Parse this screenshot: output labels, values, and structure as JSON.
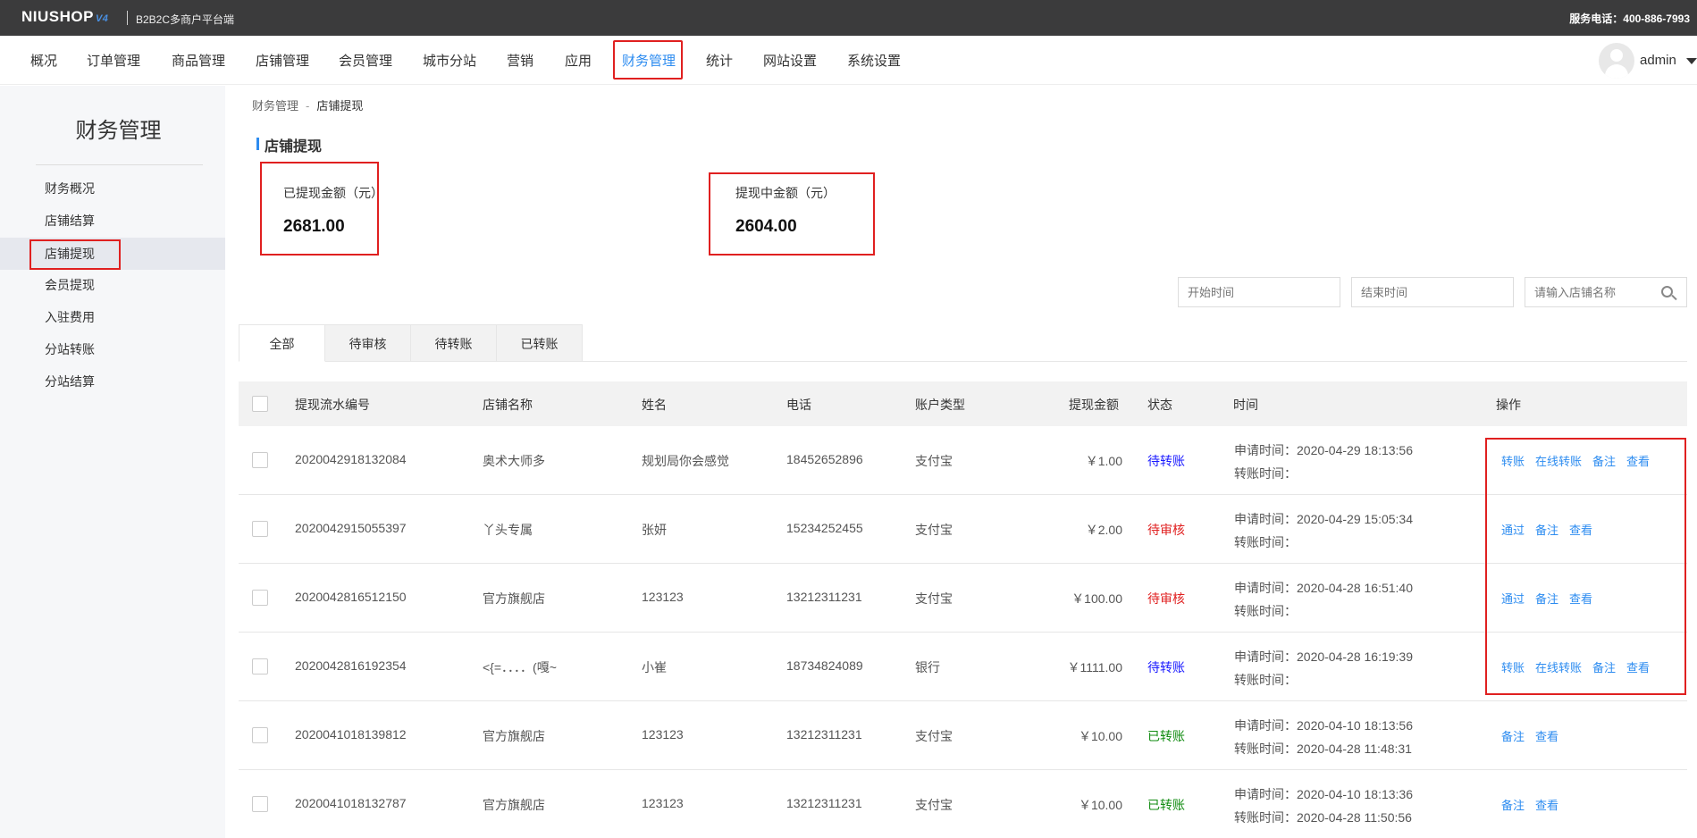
{
  "header": {
    "logo": "NIUSHOP",
    "logo_version": "V4",
    "subtitle": "B2B2C多商户平台端",
    "hotline": "服务电话：400-886-7993"
  },
  "nav": {
    "items": [
      {
        "label": "概况"
      },
      {
        "label": "订单管理"
      },
      {
        "label": "商品管理"
      },
      {
        "label": "店铺管理"
      },
      {
        "label": "会员管理"
      },
      {
        "label": "城市分站"
      },
      {
        "label": "营销"
      },
      {
        "label": "应用"
      },
      {
        "label": "财务管理",
        "active": true
      },
      {
        "label": "统计"
      },
      {
        "label": "网站设置"
      },
      {
        "label": "系统设置"
      }
    ],
    "username": "admin"
  },
  "sidebar": {
    "title": "财务管理",
    "items": [
      {
        "label": "财务概况"
      },
      {
        "label": "店铺结算"
      },
      {
        "label": "店铺提现",
        "active": true
      },
      {
        "label": "会员提现"
      },
      {
        "label": "入驻费用"
      },
      {
        "label": "分站转账"
      },
      {
        "label": "分站结算"
      }
    ]
  },
  "breadcrumb": {
    "parent": "财务管理",
    "separator": "-",
    "current": "店铺提现"
  },
  "section_title": "店铺提现",
  "stats": {
    "withdrawn_label": "已提现金额（元）",
    "withdrawn_value": "2681.00",
    "pending_label": "提现中金额（元）",
    "pending_value": "2604.00"
  },
  "filters": {
    "start_placeholder": "开始时间",
    "end_placeholder": "结束时间",
    "shop_placeholder": "请输入店铺名称"
  },
  "tabs": [
    {
      "label": "全部",
      "active": true
    },
    {
      "label": "待审核"
    },
    {
      "label": "待转账"
    },
    {
      "label": "已转账"
    }
  ],
  "table": {
    "columns": {
      "serial": "提现流水编号",
      "shop": "店铺名称",
      "name": "姓名",
      "phone": "电话",
      "account": "账户类型",
      "amount": "提现金额",
      "status": "状态",
      "time": "时间",
      "ops": "操作"
    },
    "rows": [
      {
        "serial": "2020042918132084",
        "shop": "奥术大师多",
        "name": "规划局你会感觉",
        "phone": "18452652896",
        "account": "支付宝",
        "amount": "￥1.00",
        "status": "待转账",
        "status_type": "blue",
        "apply_time": "申请时间：2020-04-29 18:13:56",
        "transfer_time": "转账时间：",
        "ops": [
          "转账",
          "在线转账",
          "备注",
          "查看"
        ]
      },
      {
        "serial": "2020042915055397",
        "shop": "丫头专属",
        "name": "张妍",
        "phone": "15234252455",
        "account": "支付宝",
        "amount": "￥2.00",
        "status": "待审核",
        "status_type": "red",
        "apply_time": "申请时间：2020-04-29 15:05:34",
        "transfer_time": "转账时间：",
        "ops": [
          "通过",
          "备注",
          "查看"
        ]
      },
      {
        "serial": "2020042816512150",
        "shop": "官方旗舰店",
        "name": "123123",
        "phone": "13212311231",
        "account": "支付宝",
        "amount": "￥100.00",
        "status": "待审核",
        "status_type": "red",
        "apply_time": "申请时间：2020-04-28 16:51:40",
        "transfer_time": "转账时间：",
        "ops": [
          "通过",
          "备注",
          "查看"
        ]
      },
      {
        "serial": "2020042816192354",
        "shop": "<{=．．．．(嘎~",
        "name": "小崔",
        "phone": "18734824089",
        "account": "银行",
        "amount": "￥1111.00",
        "status": "待转账",
        "status_type": "blue",
        "apply_time": "申请时间：2020-04-28 16:19:39",
        "transfer_time": "转账时间：",
        "ops": [
          "转账",
          "在线转账",
          "备注",
          "查看"
        ]
      },
      {
        "serial": "2020041018139812",
        "shop": "官方旗舰店",
        "name": "123123",
        "phone": "13212311231",
        "account": "支付宝",
        "amount": "￥10.00",
        "status": "已转账",
        "status_type": "green",
        "apply_time": "申请时间：2020-04-10 18:13:56",
        "transfer_time": "转账时间：2020-04-28 11:48:31",
        "ops": [
          "备注",
          "查看"
        ]
      },
      {
        "serial": "2020041018132787",
        "shop": "官方旗舰店",
        "name": "123123",
        "phone": "13212311231",
        "account": "支付宝",
        "amount": "￥10.00",
        "status": "已转账",
        "status_type": "green",
        "apply_time": "申请时间：2020-04-10 18:13:36",
        "transfer_time": "转账时间：2020-04-28 11:50:56",
        "ops": [
          "备注",
          "查看"
        ]
      }
    ]
  },
  "colors": {
    "accent": "#2d8cf0",
    "highlight_box": "#e02020",
    "topbar": "#3b3b3c"
  }
}
